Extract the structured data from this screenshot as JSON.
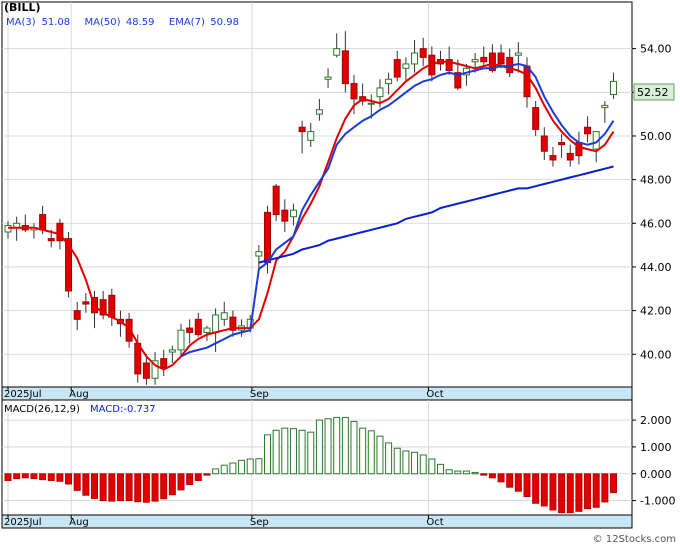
{
  "chart_data": [
    {
      "type": "candlestick",
      "title": "(BILL)",
      "legend": [
        {
          "label": "MA(3)",
          "value": "51.08",
          "color": "#d40000"
        },
        {
          "label": "MA(50)",
          "value": "48.59",
          "color": "#0a1fcf"
        },
        {
          "label": "EMA(7)",
          "value": "50.98",
          "color": "#1a3cd8"
        }
      ],
      "last_price": "52.52",
      "ylim": [
        38.5,
        56.0
      ],
      "yticks": [
        "40.00",
        "42.00",
        "44.00",
        "46.00",
        "48.00",
        "50.00",
        "52.00",
        "54.00"
      ],
      "x_labels": [
        {
          "label": "2025Jul",
          "index": 0
        },
        {
          "label": "Aug",
          "index": 7.3
        },
        {
          "label": "Sep",
          "index": 28.2
        },
        {
          "label": "Oct",
          "index": 48.6
        }
      ],
      "candles": [
        [
          45.6,
          46.1,
          45.3,
          45.9
        ],
        [
          45.8,
          46.3,
          45.2,
          46.0
        ],
        [
          45.9,
          46.4,
          45.6,
          45.7
        ],
        [
          45.7,
          46.0,
          45.3,
          45.8
        ],
        [
          46.4,
          46.8,
          45.5,
          45.7
        ],
        [
          45.3,
          45.7,
          44.9,
          45.2
        ],
        [
          46.0,
          46.2,
          44.8,
          45.2
        ],
        [
          45.3,
          45.6,
          42.6,
          42.9
        ],
        [
          42.0,
          42.4,
          41.1,
          41.6
        ],
        [
          42.4,
          42.8,
          41.9,
          42.3
        ],
        [
          42.6,
          42.9,
          41.2,
          41.9
        ],
        [
          42.5,
          42.9,
          41.6,
          41.8
        ],
        [
          42.7,
          43.0,
          41.3,
          41.7
        ],
        [
          41.6,
          42.0,
          40.8,
          41.4
        ],
        [
          41.6,
          41.9,
          40.3,
          40.6
        ],
        [
          40.5,
          40.9,
          38.7,
          39.1
        ],
        [
          39.6,
          40.0,
          38.6,
          38.9
        ],
        [
          38.9,
          40.1,
          38.6,
          39.7
        ],
        [
          39.8,
          40.2,
          39.0,
          39.4
        ],
        [
          40.1,
          40.4,
          39.6,
          40.2
        ],
        [
          40.2,
          41.4,
          39.9,
          41.1
        ],
        [
          41.2,
          41.6,
          40.5,
          41.0
        ],
        [
          41.6,
          41.9,
          40.8,
          40.9
        ],
        [
          41.0,
          41.3,
          40.6,
          41.2
        ],
        [
          41.0,
          42.1,
          40.1,
          41.8
        ],
        [
          41.6,
          42.4,
          41.3,
          41.9
        ],
        [
          41.7,
          42.0,
          40.8,
          41.1
        ],
        [
          41.1,
          41.6,
          40.8,
          41.3
        ],
        [
          41.2,
          41.8,
          41.0,
          41.6
        ],
        [
          44.5,
          45.0,
          43.9,
          44.7
        ],
        [
          46.5,
          46.8,
          43.7,
          44.2
        ],
        [
          47.7,
          47.8,
          46.1,
          46.4
        ],
        [
          46.6,
          47.1,
          45.6,
          46.1
        ],
        [
          46.3,
          46.9,
          45.9,
          46.6
        ],
        [
          50.4,
          50.7,
          49.2,
          50.2
        ],
        [
          49.8,
          50.6,
          49.5,
          50.2
        ],
        [
          51.0,
          51.7,
          50.7,
          51.2
        ],
        [
          52.6,
          53.1,
          52.2,
          52.7
        ],
        [
          53.7,
          54.7,
          53.6,
          54.0
        ],
        [
          53.9,
          54.8,
          52.0,
          52.4
        ],
        [
          52.4,
          52.8,
          51.0,
          51.7
        ],
        [
          51.8,
          52.4,
          51.4,
          51.6
        ],
        [
          51.5,
          51.9,
          50.8,
          51.5
        ],
        [
          51.8,
          52.6,
          51.3,
          52.2
        ],
        [
          52.4,
          52.9,
          51.9,
          52.6
        ],
        [
          53.5,
          53.9,
          52.5,
          52.7
        ],
        [
          53.1,
          53.6,
          52.5,
          53.3
        ],
        [
          53.3,
          54.4,
          52.9,
          53.8
        ],
        [
          54.0,
          54.5,
          53.2,
          53.6
        ],
        [
          53.7,
          54.1,
          52.5,
          52.8
        ],
        [
          53.5,
          53.9,
          53.0,
          53.3
        ],
        [
          53.5,
          54.1,
          52.8,
          53.0
        ],
        [
          52.9,
          53.5,
          52.1,
          52.2
        ],
        [
          52.8,
          53.3,
          52.3,
          53.1
        ],
        [
          53.4,
          53.8,
          52.9,
          53.5
        ],
        [
          53.6,
          54.1,
          53.2,
          53.4
        ],
        [
          53.8,
          54.2,
          52.9,
          53.0
        ],
        [
          53.8,
          54.2,
          53.1,
          53.3
        ],
        [
          53.6,
          54.0,
          52.7,
          52.9
        ],
        [
          53.7,
          54.3,
          52.9,
          53.8
        ],
        [
          53.2,
          53.6,
          51.3,
          51.8
        ],
        [
          51.3,
          51.6,
          50.0,
          50.3
        ],
        [
          50.0,
          50.4,
          48.9,
          49.3
        ],
        [
          49.1,
          49.5,
          48.6,
          48.9
        ],
        [
          49.7,
          50.1,
          49.0,
          49.6
        ],
        [
          49.2,
          49.6,
          48.6,
          48.9
        ],
        [
          49.7,
          50.2,
          48.7,
          49.1
        ],
        [
          50.4,
          50.9,
          49.7,
          50.1
        ],
        [
          49.4,
          50.2,
          48.8,
          50.2
        ],
        [
          51.3,
          51.6,
          50.6,
          51.4
        ],
        [
          51.9,
          52.9,
          51.7,
          52.5
        ]
      ],
      "series": [
        {
          "name": "MA(3)",
          "color": "#e00000",
          "values": [
            45.8,
            45.8,
            45.8,
            45.8,
            45.7,
            45.6,
            45.5,
            45.0,
            44.4,
            43.4,
            42.2,
            41.9,
            41.7,
            41.5,
            41.2,
            40.5,
            39.9,
            39.5,
            39.3,
            39.5,
            39.9,
            40.4,
            40.7,
            40.9,
            41.0,
            41.1,
            41.2,
            41.2,
            41.2,
            41.6,
            42.8,
            44.3,
            44.7,
            45.4,
            46.2,
            46.9,
            47.7,
            48.8,
            49.9,
            50.8,
            51.4,
            51.7,
            51.6,
            51.5,
            51.7,
            52.1,
            52.5,
            52.8,
            53.1,
            53.3,
            53.4,
            53.4,
            53.3,
            53.2,
            53.1,
            53.2,
            53.3,
            53.2,
            53.1,
            53.0,
            52.8,
            52.2,
            51.4,
            50.7,
            50.2,
            49.8,
            49.5,
            49.4,
            49.3,
            49.6,
            50.2
          ]
        },
        {
          "name": "MA(50)",
          "color": "#0a1fcf",
          "values": [
            null,
            null,
            null,
            null,
            null,
            null,
            null,
            null,
            null,
            null,
            null,
            null,
            null,
            null,
            null,
            null,
            null,
            null,
            null,
            null,
            null,
            null,
            null,
            null,
            null,
            null,
            null,
            null,
            null,
            44.2,
            44.3,
            44.4,
            44.5,
            44.6,
            44.8,
            44.9,
            45.0,
            45.2,
            45.3,
            45.4,
            45.5,
            45.6,
            45.7,
            45.8,
            45.9,
            46.0,
            46.2,
            46.3,
            46.4,
            46.5,
            46.7,
            46.8,
            46.9,
            47.0,
            47.1,
            47.2,
            47.3,
            47.4,
            47.5,
            47.6,
            47.6,
            47.7,
            47.8,
            47.9,
            48.0,
            48.1,
            48.2,
            48.3,
            48.4,
            48.5,
            48.6
          ]
        },
        {
          "name": "EMA(7)",
          "color": "#1a3cd8",
          "values": [
            null,
            null,
            null,
            null,
            null,
            null,
            null,
            null,
            null,
            null,
            null,
            null,
            null,
            null,
            null,
            null,
            null,
            null,
            null,
            null,
            39.9,
            40.1,
            40.2,
            40.3,
            40.5,
            40.7,
            40.9,
            41.0,
            41.1,
            43.9,
            44.2,
            44.8,
            45.1,
            45.4,
            46.6,
            47.3,
            47.9,
            48.5,
            49.6,
            50.1,
            50.4,
            50.7,
            50.9,
            51.2,
            51.4,
            51.7,
            52.0,
            52.3,
            52.5,
            52.6,
            52.8,
            52.9,
            52.8,
            52.9,
            53.0,
            53.1,
            53.1,
            53.2,
            53.2,
            53.3,
            53.2,
            52.7,
            51.8,
            51.1,
            50.5,
            50.0,
            49.7,
            49.6,
            49.7,
            50.1,
            50.7
          ]
        }
      ]
    },
    {
      "type": "bar",
      "title": "MACD(26,12,9)",
      "legend": [
        {
          "label": "MACD(26,12,9)",
          "value": "",
          "color": "#000000"
        },
        {
          "label": "MACD:",
          "value": "-0.737",
          "color": "#0a1fcf"
        }
      ],
      "ylim": [
        -1.5,
        2.6
      ],
      "yticks": [
        "2.000",
        "1.000",
        "0.000",
        "-1.000"
      ],
      "x_labels": [
        {
          "label": "2025Jul",
          "index": 0
        },
        {
          "label": "Aug",
          "index": 7.3
        },
        {
          "label": "Sep",
          "index": 28.2
        },
        {
          "label": "Oct",
          "index": 48.6
        }
      ],
      "values": [
        -0.25,
        -0.18,
        -0.15,
        -0.18,
        -0.22,
        -0.25,
        -0.28,
        -0.38,
        -0.62,
        -0.8,
        -0.92,
        -1.0,
        -1.02,
        -1.0,
        -1.0,
        -1.04,
        -1.06,
        -1.02,
        -0.93,
        -0.78,
        -0.6,
        -0.4,
        -0.25,
        -0.05,
        0.18,
        0.32,
        0.4,
        0.5,
        0.55,
        0.56,
        1.45,
        1.62,
        1.7,
        1.68,
        1.62,
        1.55,
        2.0,
        2.05,
        2.1,
        2.1,
        1.95,
        1.7,
        1.6,
        1.4,
        1.15,
        0.95,
        0.85,
        0.8,
        0.7,
        0.55,
        0.35,
        0.15,
        0.1,
        0.1,
        0.05,
        -0.05,
        -0.15,
        -0.3,
        -0.5,
        -0.65,
        -0.85,
        -1.1,
        -1.2,
        -1.35,
        -1.45,
        -1.45,
        -1.4,
        -1.3,
        -1.25,
        -1.05,
        -0.7
      ]
    }
  ],
  "watermark": "© 12Stocks.com"
}
